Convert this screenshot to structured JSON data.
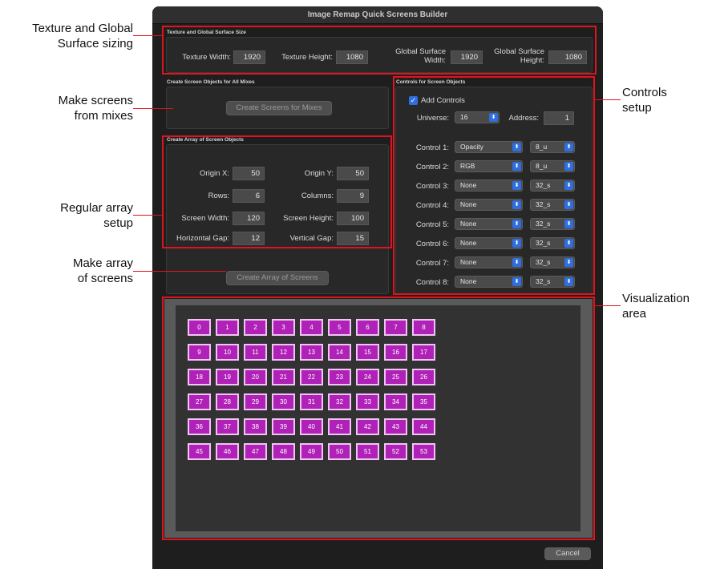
{
  "window": {
    "title": "Image Remap Quick Screens Builder"
  },
  "annotations": {
    "texture": "Texture and Global\nSurface sizing",
    "make_screens": "Make screens\nfrom mixes",
    "regular_array": "Regular array\nsetup",
    "make_array": "Make array\nof screens",
    "controls_setup": "Controls\nsetup",
    "visualization": "Visualization\narea"
  },
  "texture_group": {
    "title": "Texture and Global Surface Size",
    "texture_width_label": "Texture Width:",
    "texture_width": "1920",
    "texture_height_label": "Texture Height:",
    "texture_height": "1080",
    "global_width_label": "Global Surface Width:",
    "global_width": "1920",
    "global_height_label": "Global Surface Height:",
    "global_height": "1080"
  },
  "mixes_group": {
    "title": "Create Screen Objects for All Mixes",
    "button": "Create Screens for Mixes"
  },
  "array_group": {
    "title": "Create Array of Screen Objects",
    "origin_x_label": "Origin X:",
    "origin_x": "50",
    "origin_y_label": "Origin Y:",
    "origin_y": "50",
    "rows_label": "Rows:",
    "rows": "6",
    "columns_label": "Columns:",
    "columns": "9",
    "screen_width_label": "Screen Width:",
    "screen_width": "120",
    "screen_height_label": "Screen Height:",
    "screen_height": "100",
    "h_gap_label": "Horizontal Gap:",
    "h_gap": "12",
    "v_gap_label": "Vertical Gap:",
    "v_gap": "15",
    "button": "Create Array of Screens"
  },
  "controls_group": {
    "title": "Controls for Screen Objects",
    "add_controls_label": "Add Controls",
    "add_controls_checked": true,
    "universe_label": "Universe:",
    "universe": "16",
    "address_label": "Address:",
    "address": "1",
    "controls": [
      {
        "label": "Control 1:",
        "value": "Opacity",
        "type": "8_u"
      },
      {
        "label": "Control 2:",
        "value": "RGB",
        "type": "8_u"
      },
      {
        "label": "Control 3:",
        "value": "None",
        "type": "32_s"
      },
      {
        "label": "Control 4:",
        "value": "None",
        "type": "32_s"
      },
      {
        "label": "Control 5:",
        "value": "None",
        "type": "32_s"
      },
      {
        "label": "Control 6:",
        "value": "None",
        "type": "32_s"
      },
      {
        "label": "Control 7:",
        "value": "None",
        "type": "32_s"
      },
      {
        "label": "Control 8:",
        "value": "None",
        "type": "32_s"
      }
    ]
  },
  "visualization": {
    "rows": 6,
    "columns": 9,
    "cells": [
      "0",
      "1",
      "2",
      "3",
      "4",
      "5",
      "6",
      "7",
      "8",
      "9",
      "10",
      "11",
      "12",
      "13",
      "14",
      "15",
      "16",
      "17",
      "18",
      "19",
      "20",
      "21",
      "22",
      "23",
      "24",
      "25",
      "26",
      "27",
      "28",
      "29",
      "30",
      "31",
      "32",
      "33",
      "34",
      "35",
      "36",
      "37",
      "38",
      "39",
      "40",
      "41",
      "42",
      "43",
      "44",
      "45",
      "46",
      "47",
      "48",
      "49",
      "50",
      "51",
      "52",
      "53"
    ],
    "cell_color": "#b021b8",
    "cell_border": "#efc4f2"
  },
  "footer": {
    "cancel": "Cancel"
  },
  "colors": {
    "highlight": "#e0141c",
    "accent": "#2f6ee0"
  }
}
